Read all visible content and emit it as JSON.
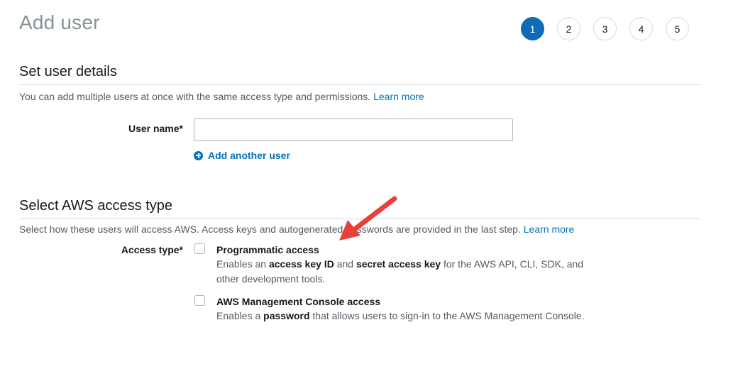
{
  "page": {
    "title": "Add user"
  },
  "wizard": {
    "steps": [
      "1",
      "2",
      "3",
      "4",
      "5"
    ],
    "active_step": "1",
    "active_color": "#0d6bb8"
  },
  "user_details": {
    "heading": "Set user details",
    "description": "You can add multiple users at once with the same access type and permissions.",
    "learn_more": "Learn more",
    "username_label": "User name*",
    "username_value": "",
    "add_another_label": "Add another user",
    "add_another_icon": "plus-circle-icon"
  },
  "access_type": {
    "heading": "Select AWS access type",
    "description": "Select how these users will access AWS. Access keys and autogenerated passwords are provided in the last step.",
    "learn_more": "Learn more",
    "label": "Access type*",
    "options": [
      {
        "title": "Programmatic access",
        "desc_parts": [
          "Enables an ",
          "access key ID",
          " and ",
          "secret access key",
          " for the AWS API, CLI, SDK, and other development tools."
        ],
        "checked": false
      },
      {
        "title": "AWS Management Console access",
        "desc_parts": [
          "Enables a ",
          "password",
          " that allows users to sign-in to the AWS Management Console."
        ],
        "checked": false
      }
    ]
  },
  "annotation": {
    "arrow_color": "#e8413a"
  },
  "colors": {
    "link": "#0073bb"
  }
}
